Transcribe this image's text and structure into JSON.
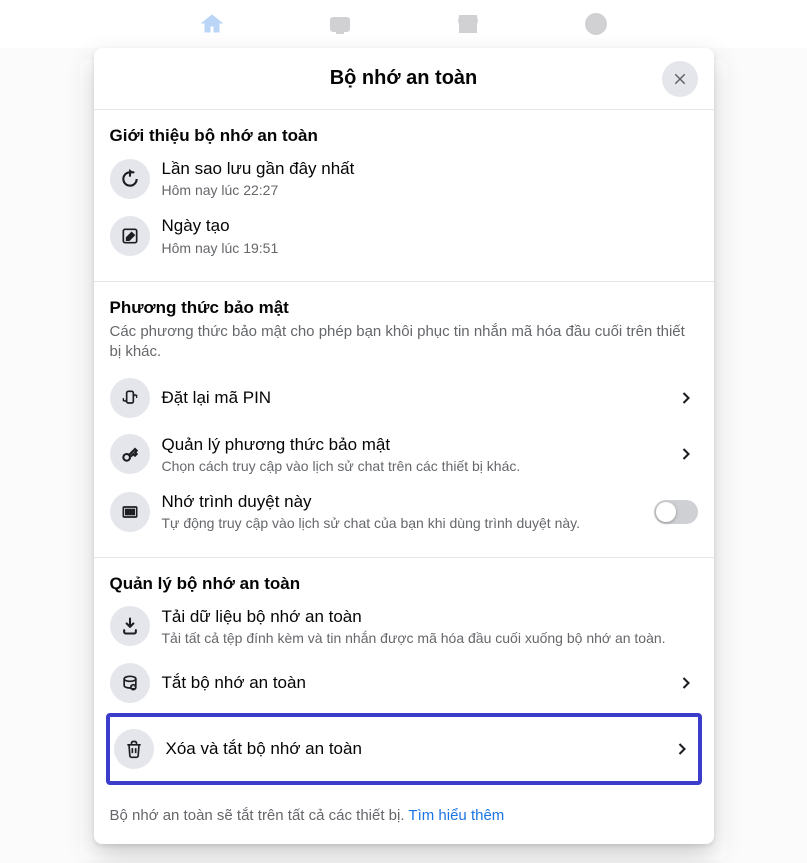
{
  "modal": {
    "title": "Bộ nhớ an toàn"
  },
  "intro": {
    "title": "Giới thiệu bộ nhớ an toàn",
    "backup": {
      "label": "Lần sao lưu gần đây nhất",
      "time": "Hôm nay lúc 22:27"
    },
    "created": {
      "label": "Ngày tạo",
      "time": "Hôm nay lúc 19:51"
    }
  },
  "security": {
    "title": "Phương thức bảo mật",
    "desc": "Các phương thức bảo mật cho phép bạn khôi phục tin nhắn mã hóa đầu cuối trên thiết bị khác.",
    "reset_pin": "Đặt lại mã PIN",
    "manage": {
      "label": "Quản lý phương thức bảo mật",
      "sub": "Chọn cách truy cập vào lịch sử chat trên các thiết bị khác."
    },
    "remember": {
      "label": "Nhớ trình duyệt này",
      "sub": "Tự động truy cập vào lịch sử chat của bạn khi dùng trình duyệt này."
    }
  },
  "manage": {
    "title": "Quản lý bộ nhớ an toàn",
    "download": {
      "label": "Tải dữ liệu bộ nhớ an toàn",
      "sub": "Tải tất cả tệp đính kèm và tin nhắn được mã hóa đầu cuối xuống bộ nhớ an toàn."
    },
    "turn_off": "Tắt bộ nhớ an toàn",
    "delete_off": "Xóa và tắt bộ nhớ an toàn"
  },
  "footer": {
    "text": "Bộ nhớ an toàn sẽ tắt trên tất cả các thiết bị. ",
    "link": "Tìm hiểu thêm"
  }
}
